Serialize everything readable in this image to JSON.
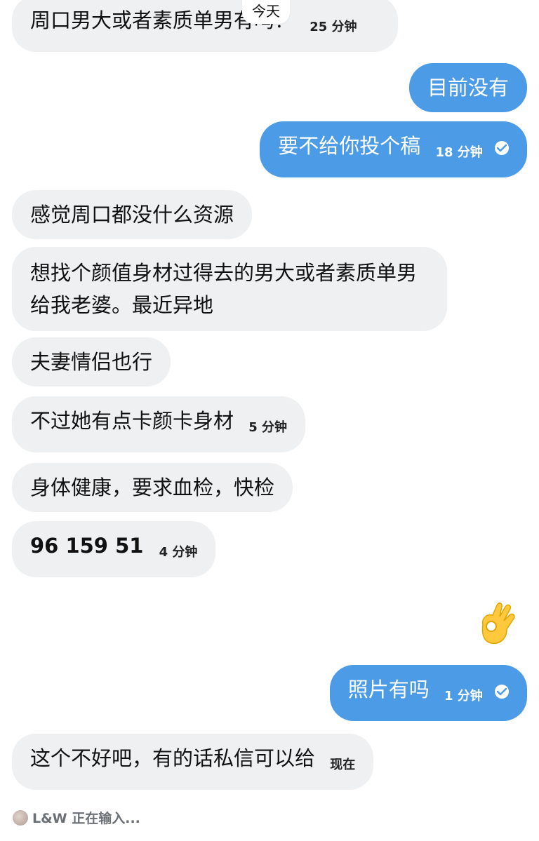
{
  "date_divider": "今天",
  "messages": [
    {
      "side": "in",
      "text": "周口男大或者素质单男有吗？",
      "time": "25 分钟"
    },
    {
      "side": "out",
      "text": "目前没有",
      "time": ""
    },
    {
      "side": "out",
      "text": "要不给你投个稿",
      "time": "18 分钟"
    },
    {
      "side": "in",
      "text": "感觉周口都没什么资源",
      "time": ""
    },
    {
      "side": "in",
      "text": "想找个颜值身材过得去的男大或者素质单男给我老婆。最近异地",
      "time": ""
    },
    {
      "side": "in",
      "text": "夫妻情侣也行",
      "time": ""
    },
    {
      "side": "in",
      "text": "不过她有点卡颜卡身材",
      "time": "5 分钟"
    },
    {
      "side": "in",
      "text": "身体健康，要求血检，快检",
      "time": ""
    },
    {
      "side": "in",
      "text": "96 159 51",
      "time": "4 分钟"
    },
    {
      "side": "out",
      "text": "照片有吗",
      "time": "1 分钟"
    },
    {
      "side": "in",
      "text": "这个不好吧，有的话私信可以给",
      "time": "现在"
    }
  ],
  "emoji_reaction": "ok-hand-emoji",
  "typing_indicator": {
    "user": "L&W",
    "text": "L&W 正在输入..."
  },
  "colors": {
    "outgoing_bubble": "#4b9be6",
    "incoming_bubble": "#eef0f2"
  }
}
